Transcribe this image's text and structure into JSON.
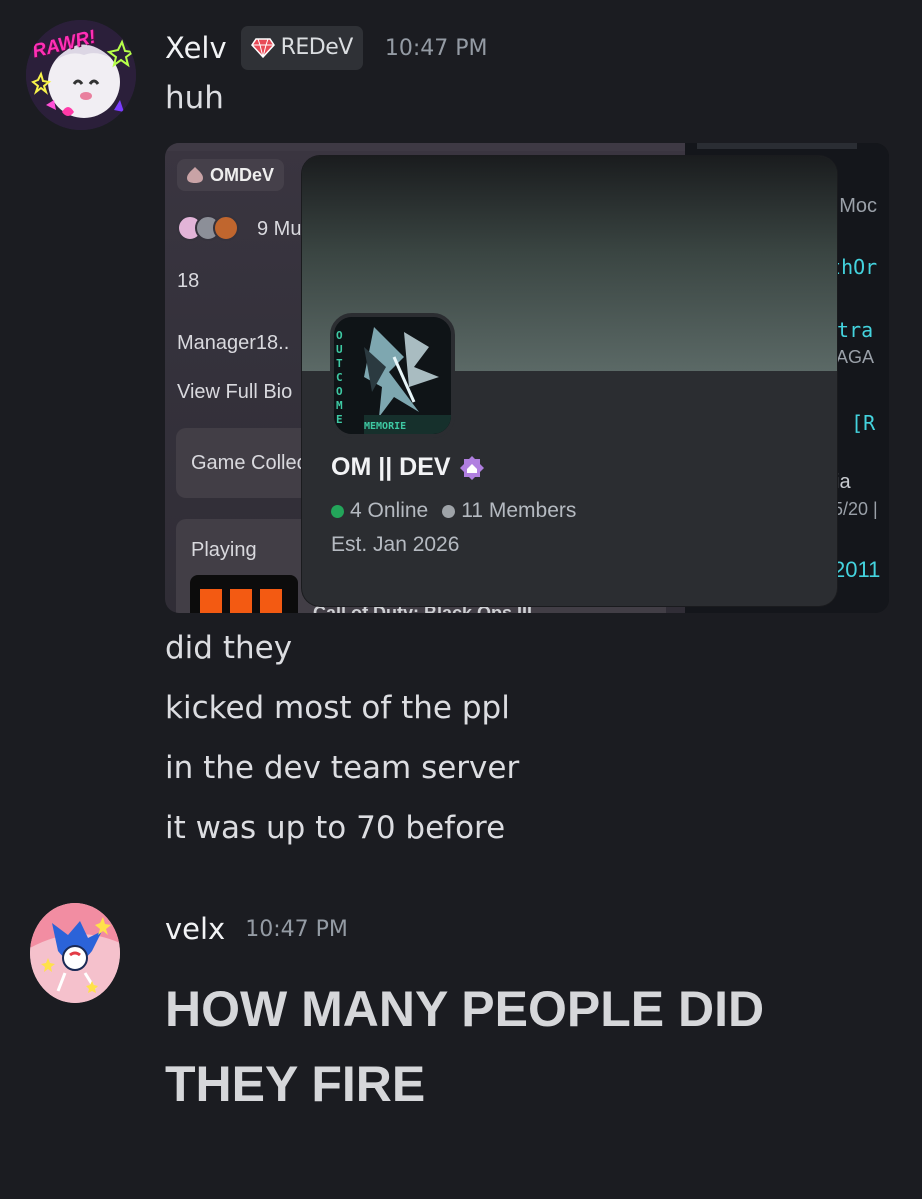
{
  "messages": [
    {
      "username": "Xelv",
      "tag": "REDeV",
      "timestamp": "10:47 PM",
      "avatar_text": "RAWR!",
      "lines": [
        "huh",
        "did they",
        "kicked most of the ppl",
        "in the dev team server",
        "it was up to 70 before"
      ]
    },
    {
      "username": "velx",
      "timestamp": "10:47 PM",
      "big_lines": [
        "HOW MANY PEOPLE DID",
        "THEY FIRE"
      ]
    }
  ],
  "embed": {
    "left": {
      "pill": "OMDeV",
      "mutuals": "9 Mu",
      "age": "18",
      "role": "Manager18..",
      "view_bio": "View Full Bio",
      "game_collection": "Game Collec",
      "playing": "Playing"
    },
    "right": [
      "r Moc",
      "ıthOr",
      "stra (",
      "k AGA",
      "ɛe [R",
      "\\lia",
      "5/20 |",
      "2011"
    ],
    "popup": {
      "server_name": "OM || DEV",
      "online": "4 Online",
      "members": "11 Members",
      "established": "Est. Jan 2026",
      "icon_side_text": "OUTCOME",
      "icon_bottom_text": "MEMORIE",
      "peek_text": "Call of Duty: Black Ops III"
    },
    "colors": {
      "online_dot": "#23a55a",
      "members_dot": "#9ea3a8",
      "right_cyan": "#44d3de",
      "boost_badge": "#b07fe0"
    }
  }
}
